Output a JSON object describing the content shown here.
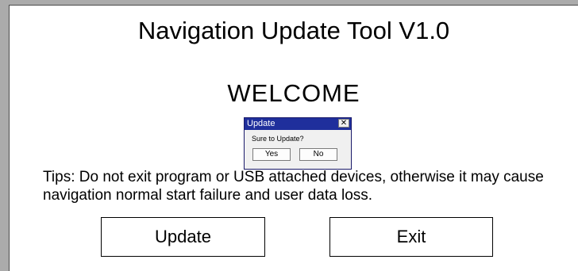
{
  "app": {
    "title": "Navigation Update Tool V1.0",
    "welcome": "WELCOME",
    "tips": "Tips: Do not exit program or USB attached devices, otherwise it may cause navigation normal start failure and user data loss."
  },
  "buttons": {
    "update_label": "Update",
    "exit_label": "Exit"
  },
  "dialog": {
    "title": "Update",
    "message": "Sure to Update?",
    "yes_label": "Yes",
    "no_label": "No",
    "close_glyph": "✕"
  },
  "colors": {
    "background": "#ababab",
    "window": "#ffffff",
    "dialog_titlebar": "#1f2f9c",
    "dialog_body": "#f0f0f0"
  }
}
